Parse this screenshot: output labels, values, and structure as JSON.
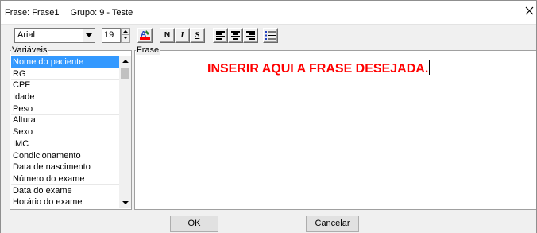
{
  "window": {
    "title_frase": "Frase: Frase1",
    "title_grupo": "Grupo: 9 - Teste",
    "close_glyph": "✕"
  },
  "toolbar": {
    "font_name": "Arial",
    "font_size": "19",
    "bold_label": "N",
    "italic_label": "I",
    "underline_label": "S",
    "color_icon": "text-color-icon"
  },
  "variables": {
    "label": "Variáveis",
    "items": [
      "Nome do paciente",
      "RG",
      "CPF",
      "Idade",
      "Peso",
      "Altura",
      "Sexo",
      "IMC",
      "Condicionamento",
      "Data de nascimento",
      "Número do exame",
      "Data do exame",
      "Horário do exame"
    ],
    "selected": "Nome do paciente"
  },
  "editor": {
    "label": "Frase",
    "content": "INSERIR AQUI A FRASE DESEJADA.",
    "text_color": "#ff0000"
  },
  "footer": {
    "ok_label": "OK",
    "cancel_label": "Cancelar"
  }
}
